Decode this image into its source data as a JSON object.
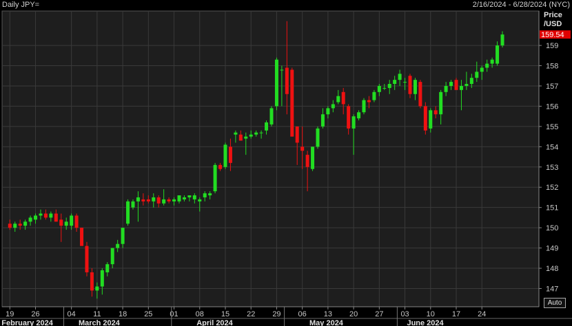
{
  "header": {
    "title": "Daily JPY=",
    "date_range": "2/16/2024 - 6/28/2024 (NYC)"
  },
  "auto_button": "Auto",
  "colors": {
    "up": "#22dd22",
    "down": "#ee1111",
    "background": "#1e1e1e",
    "grid": "#3a3a3a"
  },
  "chart_data": {
    "type": "candlestick",
    "title": "",
    "ylabel_lines": [
      "Price",
      "/USD"
    ],
    "last_price_label": "159.54",
    "ylim": [
      146.1,
      160.7
    ],
    "yticks": [
      147,
      148,
      149,
      150,
      151,
      152,
      153,
      154,
      155,
      156,
      157,
      158,
      159
    ],
    "x_tick_labels": [
      {
        "i": 0,
        "label": "19"
      },
      {
        "i": 5,
        "label": "26"
      },
      {
        "i": 12,
        "label": "04"
      },
      {
        "i": 17,
        "label": "11"
      },
      {
        "i": 22,
        "label": "18"
      },
      {
        "i": 27,
        "label": "25"
      },
      {
        "i": 32,
        "label": "01"
      },
      {
        "i": 37,
        "label": "08"
      },
      {
        "i": 42,
        "label": "15"
      },
      {
        "i": 47,
        "label": "22"
      },
      {
        "i": 52,
        "label": "29"
      },
      {
        "i": 57,
        "label": "06"
      },
      {
        "i": 62,
        "label": "13"
      },
      {
        "i": 67,
        "label": "20"
      },
      {
        "i": 72,
        "label": "27"
      },
      {
        "i": 77,
        "label": "03"
      },
      {
        "i": 82,
        "label": "10"
      },
      {
        "i": 87,
        "label": "17"
      },
      {
        "i": 92,
        "label": "24"
      }
    ],
    "month_labels": [
      {
        "i": 0,
        "label": "February 2024"
      },
      {
        "i": 15,
        "label": "March 2024"
      },
      {
        "i": 38,
        "label": "April 2024"
      },
      {
        "i": 60,
        "label": "May 2024"
      },
      {
        "i": 79,
        "label": "June 2024"
      }
    ],
    "month_boundaries": [
      11,
      32,
      54,
      76
    ],
    "candles": [
      [
        150.2,
        150.4,
        149.9,
        150.0
      ],
      [
        150.0,
        150.3,
        149.8,
        150.2
      ],
      [
        150.2,
        150.4,
        149.9,
        150.1
      ],
      [
        150.1,
        150.4,
        149.9,
        150.3
      ],
      [
        150.3,
        150.6,
        150.1,
        150.5
      ],
      [
        150.4,
        150.7,
        150.2,
        150.6
      ],
      [
        150.6,
        150.9,
        150.4,
        150.7
      ],
      [
        150.7,
        150.9,
        150.4,
        150.5
      ],
      [
        150.5,
        150.8,
        150.3,
        150.7
      ],
      [
        150.7,
        150.9,
        150.3,
        150.3
      ],
      [
        150.4,
        150.7,
        149.3,
        150.1
      ],
      [
        150.1,
        150.5,
        149.9,
        150.3
      ],
      [
        150.1,
        150.7,
        149.9,
        150.6
      ],
      [
        150.6,
        150.7,
        149.8,
        150.0
      ],
      [
        150.0,
        150.0,
        149.2,
        149.1
      ],
      [
        149.1,
        149.3,
        147.6,
        147.8
      ],
      [
        147.8,
        148.0,
        146.6,
        146.9
      ],
      [
        146.9,
        147.3,
        146.5,
        147.1
      ],
      [
        147.1,
        148.0,
        146.7,
        147.9
      ],
      [
        147.8,
        148.3,
        147.6,
        148.2
      ],
      [
        148.2,
        149.0,
        148.0,
        149.0
      ],
      [
        149.0,
        149.4,
        148.8,
        149.2
      ],
      [
        149.2,
        150.0,
        149.0,
        150.0
      ],
      [
        150.2,
        151.4,
        150.1,
        151.3
      ],
      [
        151.0,
        151.4,
        150.9,
        151.3
      ],
      [
        151.3,
        151.8,
        150.3,
        151.5
      ],
      [
        151.4,
        151.7,
        151.1,
        151.3
      ],
      [
        151.4,
        151.6,
        151.2,
        151.3
      ],
      [
        151.3,
        151.7,
        151.0,
        151.5
      ],
      [
        151.5,
        151.6,
        151.0,
        151.2
      ],
      [
        151.2,
        151.9,
        151.1,
        151.4
      ],
      [
        151.4,
        151.5,
        151.2,
        151.3
      ],
      [
        151.3,
        151.5,
        151.1,
        151.4
      ],
      [
        151.3,
        151.6,
        151.2,
        151.6
      ],
      [
        151.4,
        151.6,
        151.3,
        151.5
      ],
      [
        151.5,
        151.6,
        151.3,
        151.6
      ],
      [
        151.4,
        151.7,
        151.2,
        151.6
      ],
      [
        151.3,
        151.5,
        150.8,
        151.4
      ],
      [
        151.5,
        151.8,
        151.3,
        151.7
      ],
      [
        151.6,
        151.8,
        151.4,
        151.7
      ],
      [
        151.8,
        153.2,
        151.7,
        153.1
      ],
      [
        153.1,
        153.2,
        152.8,
        152.9
      ],
      [
        153.0,
        154.2,
        152.9,
        154.1
      ],
      [
        154.0,
        154.4,
        152.8,
        153.2
      ],
      [
        154.6,
        154.8,
        154.2,
        154.7
      ],
      [
        154.6,
        154.8,
        154.3,
        154.3
      ],
      [
        154.4,
        154.7,
        153.6,
        154.5
      ],
      [
        154.5,
        154.8,
        154.4,
        154.6
      ],
      [
        154.6,
        154.8,
        154.5,
        154.7
      ],
      [
        154.7,
        154.8,
        154.4,
        154.7
      ],
      [
        154.8,
        155.3,
        154.6,
        155.2
      ],
      [
        155.1,
        156.0,
        155.0,
        155.9
      ],
      [
        156.0,
        158.4,
        155.8,
        158.3
      ],
      [
        157.8,
        158.0,
        156.0,
        157.8
      ],
      [
        157.9,
        160.2,
        155.6,
        156.6
      ],
      [
        157.8,
        157.9,
        154.5,
        154.5
      ],
      [
        155.0,
        155.0,
        153.1,
        154.2
      ],
      [
        154.0,
        155.0,
        152.9,
        153.8
      ],
      [
        153.6,
        153.8,
        151.8,
        153.0
      ],
      [
        152.9,
        154.0,
        152.8,
        154.0
      ],
      [
        154.0,
        155.0,
        153.9,
        154.9
      ],
      [
        155.0,
        155.9,
        154.9,
        155.6
      ],
      [
        155.6,
        156.0,
        155.4,
        155.9
      ],
      [
        155.9,
        156.3,
        155.7,
        156.1
      ],
      [
        156.2,
        156.8,
        156.1,
        156.5
      ],
      [
        156.7,
        156.9,
        155.6,
        156.1
      ],
      [
        156.0,
        156.1,
        154.6,
        154.9
      ],
      [
        154.9,
        155.6,
        153.6,
        155.5
      ],
      [
        155.4,
        155.8,
        155.3,
        155.7
      ],
      [
        155.7,
        156.4,
        155.6,
        156.3
      ],
      [
        156.3,
        156.5,
        155.9,
        156.2
      ],
      [
        156.3,
        156.8,
        156.2,
        156.7
      ],
      [
        156.7,
        157.1,
        156.5,
        157.0
      ],
      [
        156.9,
        157.1,
        156.8,
        156.9
      ],
      [
        156.9,
        157.3,
        156.6,
        157.1
      ],
      [
        157.1,
        157.5,
        156.8,
        157.3
      ],
      [
        157.3,
        157.8,
        157.0,
        157.6
      ],
      [
        157.2,
        157.4,
        156.8,
        157.2
      ],
      [
        157.5,
        157.6,
        156.4,
        156.6
      ],
      [
        156.6,
        157.4,
        156.3,
        157.3
      ],
      [
        157.2,
        157.3,
        155.9,
        156.0
      ],
      [
        156.0,
        156.2,
        154.6,
        154.8
      ],
      [
        154.9,
        155.9,
        154.7,
        155.8
      ],
      [
        155.8,
        156.0,
        155.4,
        155.6
      ],
      [
        155.6,
        156.8,
        155.1,
        156.7
      ],
      [
        156.7,
        157.2,
        156.5,
        157.0
      ],
      [
        157.0,
        157.3,
        156.8,
        157.2
      ],
      [
        157.3,
        157.4,
        156.9,
        156.8
      ],
      [
        156.8,
        157.3,
        155.8,
        157.0
      ],
      [
        157.0,
        157.7,
        156.8,
        157.1
      ],
      [
        157.1,
        157.6,
        156.9,
        157.4
      ],
      [
        157.4,
        158.2,
        157.2,
        157.7
      ],
      [
        157.7,
        158.0,
        157.3,
        157.9
      ],
      [
        157.9,
        158.3,
        157.7,
        158.1
      ],
      [
        158.1,
        158.4,
        157.9,
        158.3
      ],
      [
        158.1,
        159.2,
        158.0,
        159.0
      ],
      [
        159.0,
        159.7,
        158.9,
        159.54
      ]
    ]
  }
}
